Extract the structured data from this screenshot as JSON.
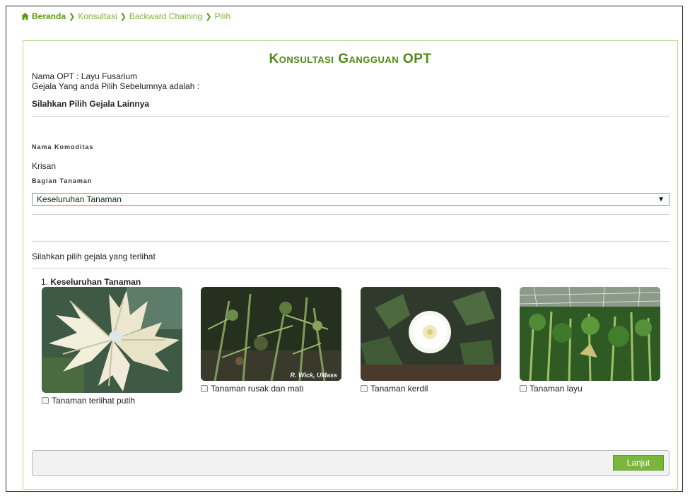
{
  "breadcrumb": {
    "home": "Beranda",
    "items": [
      "Konsultasi",
      "Backward Chaining",
      "Pilih"
    ]
  },
  "page": {
    "title": "Konsultasi Gangguan OPT",
    "opt_line": "Nama OPT : Layu Fusarium",
    "previous_symptom_line": "Gejala Yang anda Pilih Sebelumnya adalah :",
    "instruction": "Silahkan Pilih Gejala Lainnya"
  },
  "form": {
    "commodity_label": "Nama Komoditas",
    "commodity_value": "Krisan",
    "plant_part_label": "Bagian Tanaman",
    "plant_part_selected": "Keseluruhan Tanaman"
  },
  "symptoms": {
    "prompt": "Silahkan pilih gejala yang terlihat",
    "group_number": "1.",
    "group_title": "Keseluruhan Tanaman",
    "items": [
      {
        "label": "Tanaman terlihat putih"
      },
      {
        "label": "Tanaman rusak dan mati",
        "credit": "R. Wick, UMass"
      },
      {
        "label": "Tanaman kerdil"
      },
      {
        "label": "Tanaman layu"
      }
    ]
  },
  "actions": {
    "next_label": "Lanjut"
  },
  "colors": {
    "accent": "#4d8a14",
    "button": "#7ab63b",
    "border": "#b8d98f"
  }
}
